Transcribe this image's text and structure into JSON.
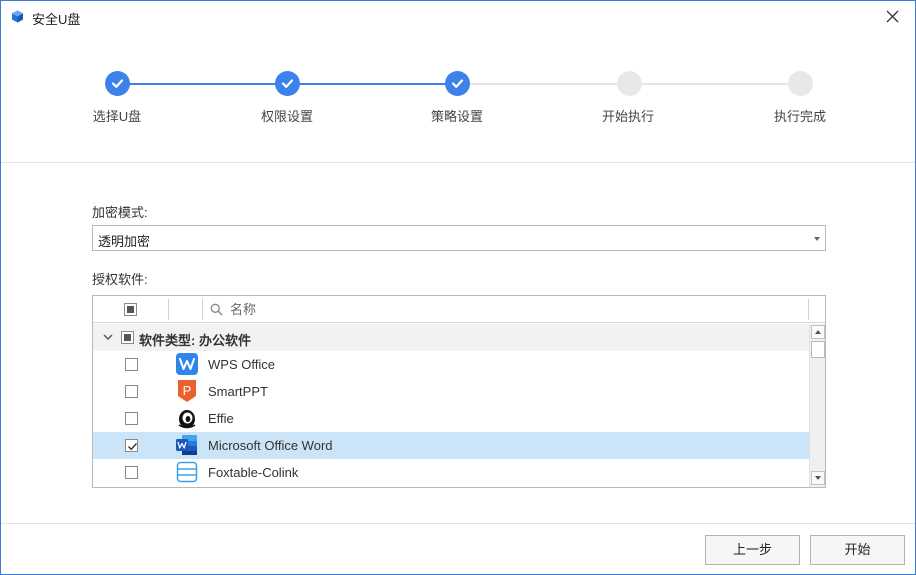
{
  "window": {
    "title": "安全U盘",
    "accent_color": "#3d82ea"
  },
  "steps": [
    {
      "label": "选择U盘",
      "status": "done"
    },
    {
      "label": "权限设置",
      "status": "done"
    },
    {
      "label": "策略设置",
      "status": "done"
    },
    {
      "label": "开始执行",
      "status": "todo"
    },
    {
      "label": "执行完成",
      "status": "todo"
    }
  ],
  "form": {
    "encryption_mode_label": "加密模式:",
    "encryption_mode_value": "透明加密",
    "authorized_software_label": "授权软件:"
  },
  "table": {
    "search_placeholder": "名称",
    "group": {
      "label": "软件类型: 办公软件",
      "expanded": true,
      "checkbox_state": "indeterminate"
    },
    "rows": [
      {
        "name": "WPS Office",
        "icon": "wps-office-icon",
        "checked": false,
        "selected": false
      },
      {
        "name": "SmartPPT",
        "icon": "smartppt-icon",
        "checked": false,
        "selected": false
      },
      {
        "name": "Effie",
        "icon": "effie-icon",
        "checked": false,
        "selected": false
      },
      {
        "name": "Microsoft Office Word",
        "icon": "microsoft-word-icon",
        "checked": true,
        "selected": true
      },
      {
        "name": "Foxtable-Colink",
        "icon": "foxtable-colink-icon",
        "checked": false,
        "selected": false
      }
    ]
  },
  "footer": {
    "prev_label": "上一步",
    "start_label": "开始"
  }
}
